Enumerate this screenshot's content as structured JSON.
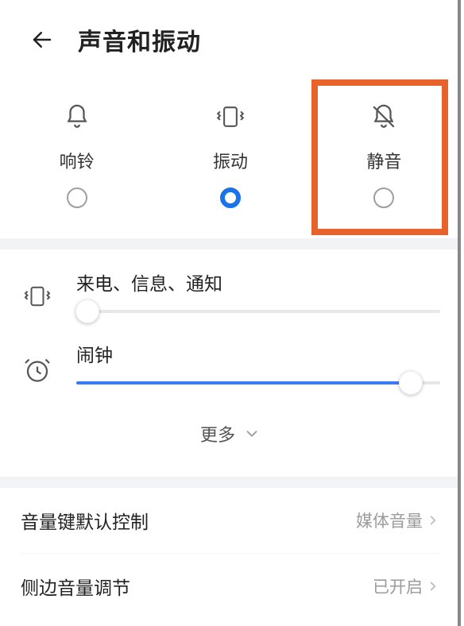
{
  "header": {
    "title": "声音和振动"
  },
  "modes": {
    "items": [
      {
        "label": "响铃",
        "selected": false
      },
      {
        "label": "振动",
        "selected": true
      },
      {
        "label": "静音",
        "selected": false
      }
    ],
    "highlight_index": 2
  },
  "sliders": {
    "notifications": {
      "label": "来电、信息、通知",
      "value_percent": 3
    },
    "alarm": {
      "label": "闹钟",
      "value_percent": 92
    }
  },
  "more_label": "更多",
  "list": {
    "volume_key": {
      "label": "音量键默认控制",
      "value": "媒体音量"
    },
    "side_volume": {
      "label": "侧边音量调节",
      "value": "已开启"
    }
  }
}
